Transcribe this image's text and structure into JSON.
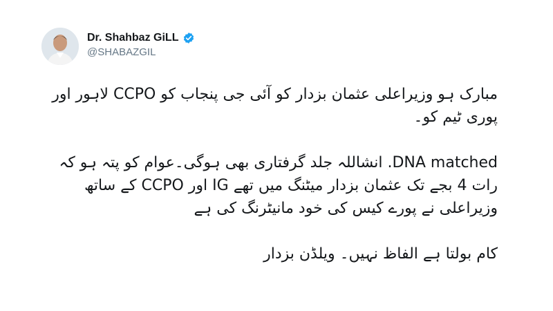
{
  "author": {
    "display_name": "Dr. Shahbaz GiLL",
    "handle": "@SHABAZGIL",
    "verified_icon": "verified-badge-icon",
    "verified_color": "#1da1f2"
  },
  "tweet": {
    "paragraphs": [
      [
        "مبارک ہو وزیراعلی عثمان بزدار کو آئی جی پنجاب کو CCPO لاہور اور",
        "پوری ٹیم کو۔"
      ],
      [
        "DNA matched.  انشاللہ جلد گرفتاری بھی ہوگی۔عوام کو پتہ ہو کہ",
        "رات 4 بجے تک عثمان بزدار میٹنگ میں تھے IG اور CCPO کے ساتھ",
        "وزیراعلی نے پورے کیس کی خود مانیٹرنگ کی ہے"
      ],
      [
        "کام بولتا ہے الفاظ نہیں۔ ویلڈن بزدار"
      ]
    ]
  }
}
